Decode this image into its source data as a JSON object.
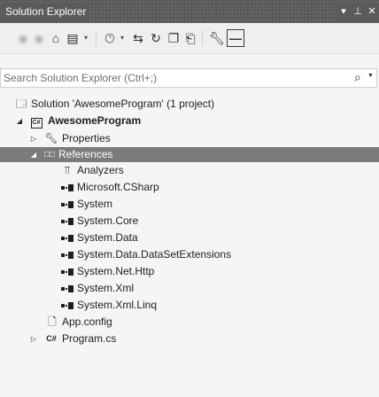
{
  "window": {
    "title": "Solution Explorer",
    "controls": {
      "dropdown": "▾",
      "pin": "⊥",
      "close": "✕"
    }
  },
  "toolbar": {
    "back_icon": "back-arrow-icon",
    "forward_icon": "forward-arrow-icon",
    "home_icon": "home-icon",
    "switch_views_icon": "switch-views-icon",
    "pending_changes_icon": "pending-changes-filter-icon",
    "sync_icon": "sync-with-active-document-icon",
    "refresh_icon": "refresh-icon",
    "collapse_all_icon": "collapse-all-icon",
    "show_all_files_icon": "show-all-files-icon",
    "properties_icon": "properties-wrench-icon",
    "preview_icon": "preview-selected-items-icon"
  },
  "search": {
    "placeholder": "Search Solution Explorer (Ctrl+;)",
    "value": ""
  },
  "tree": {
    "solution": "Solution 'AwesomeProgram' (1 project)",
    "project": "AwesomeProgram",
    "properties": "Properties",
    "references": "References",
    "analyzers": "Analyzers",
    "reference_items": [
      "Microsoft.CSharp",
      "System",
      "System.Core",
      "System.Data",
      "System.Data.DataSetExtensions",
      "System.Net.Http",
      "System.Xml",
      "System.Xml.Linq"
    ],
    "app_config": "App.config",
    "program_cs": "Program.cs"
  },
  "colors": {
    "title_bar": "#5a5a5a",
    "selected_row": "#7b7b7b",
    "background": "#f5f5f5"
  }
}
